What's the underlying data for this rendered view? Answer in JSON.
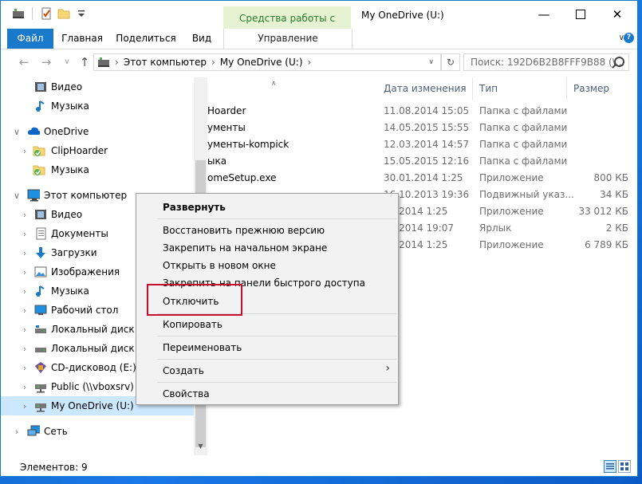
{
  "window": {
    "title": "My OneDrive (U:)",
    "contextual_group": "Средства работы с дисками",
    "accent": "#1979ca"
  },
  "ribbon": {
    "tabs": [
      "Файл",
      "Главная",
      "Поделиться",
      "Вид"
    ],
    "contextual_tab": "Управление"
  },
  "address": {
    "breadcrumb": [
      "Этот компьютер",
      "My OneDrive (U:)"
    ],
    "search_placeholder": "Поиск: 192D6B2B8FFF9B88 (\\..."
  },
  "nav": {
    "items": [
      {
        "label": "Видео",
        "icon": "video-icon"
      },
      {
        "label": "Музыка",
        "icon": "music-icon"
      },
      {
        "label": "OneDrive",
        "icon": "cloud-icon"
      },
      {
        "label": "ClipHoarder",
        "icon": "folder-synced-icon"
      },
      {
        "label": "Музыка",
        "icon": "folder-synced-icon"
      },
      {
        "label": "Этот компьютер",
        "icon": "computer-icon"
      },
      {
        "label": "Видео",
        "icon": "video-icon"
      },
      {
        "label": "Документы",
        "icon": "documents-icon"
      },
      {
        "label": "Загрузки",
        "icon": "download-icon"
      },
      {
        "label": "Изображения",
        "icon": "pictures-icon"
      },
      {
        "label": "Музыка",
        "icon": "music-icon"
      },
      {
        "label": "Рабочий стол",
        "icon": "desktop-icon"
      },
      {
        "label": "Локальный диск (C",
        "icon": "drive-icon"
      },
      {
        "label": "Локальный диск (D",
        "icon": "drive-icon"
      },
      {
        "label": "CD-дисковод (E:) Vi",
        "icon": "cd-drive-icon"
      },
      {
        "label": "Public (\\\\vboxsrv) (F",
        "icon": "network-drive-icon"
      },
      {
        "label": "My OneDrive (U:)",
        "icon": "network-drive-icon"
      },
      {
        "label": "Сеть",
        "icon": "network-icon"
      }
    ]
  },
  "columns": {
    "date": "Дата изменения",
    "type": "Тип",
    "size": "Размер"
  },
  "files": [
    {
      "name": "Hoarder",
      "date": "11.08.2014 15:05",
      "type": "Папка с файлами",
      "size": ""
    },
    {
      "name": "ументы",
      "date": "14.05.2015 15:55",
      "type": "Папка с файлами",
      "size": ""
    },
    {
      "name": "ументы-kompick",
      "date": "12.03.2014 14:57",
      "type": "Папка с файлами",
      "size": ""
    },
    {
      "name": "ыка",
      "date": "15.05.2015 12:16",
      "type": "Папка с файлами",
      "size": ""
    },
    {
      "name": "omeSetup.exe",
      "date": "30.01.2014 1:25",
      "type": "Приложение",
      "size": "800 КБ"
    },
    {
      "name": "",
      "date": "16.10.2013 19:36",
      "type": "Подвижный указ...",
      "size": "34 КБ"
    },
    {
      "name": "",
      "date": "01.2014 1:25",
      "type": "Приложение",
      "size": "33 012 КБ"
    },
    {
      "name": "",
      "date": "09.2014 19:07",
      "type": "Ярлык",
      "size": "2 КБ"
    },
    {
      "name": "",
      "date": "01.2014 1:25",
      "type": "Приложение",
      "size": "6 789 КБ"
    }
  ],
  "context_menu": {
    "expand": "Развернуть",
    "restore": "Восстановить прежнюю версию",
    "pin_start": "Закрепить на начальном экране",
    "open_new": "Открыть в новом окне",
    "pin_quick": "Закрепить на панели быстрого доступа",
    "disconnect": "Отключить",
    "copy": "Копировать",
    "rename": "Переименовать",
    "create": "Создать",
    "properties": "Свойства",
    "highlight_color": "#c8102e"
  },
  "status": {
    "items": "Элементов: 9"
  }
}
